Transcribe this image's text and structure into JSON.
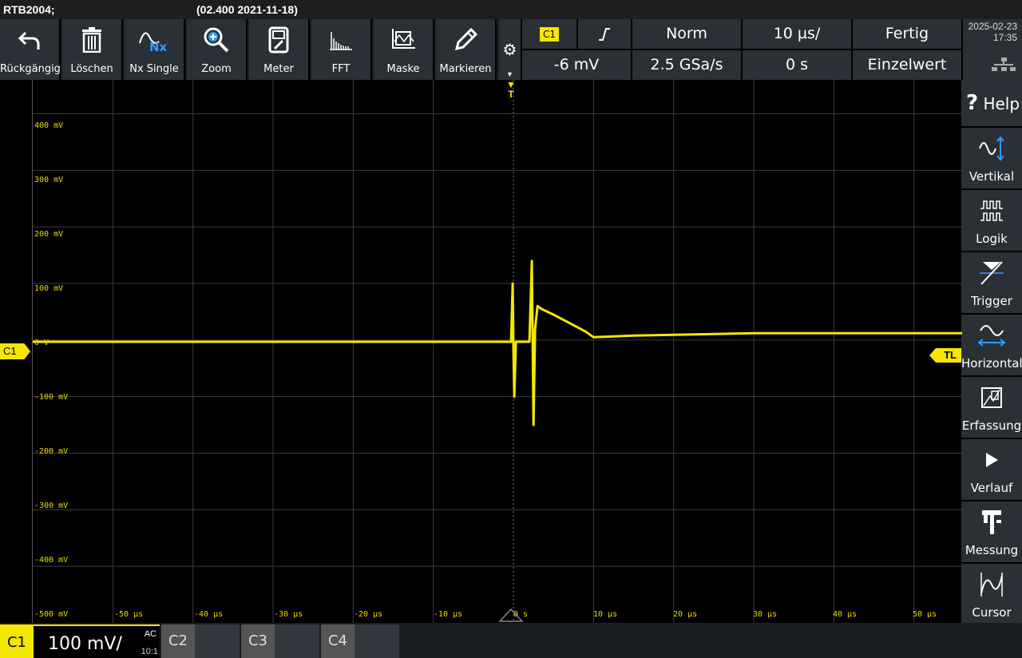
{
  "title": {
    "device": "RTB2004;",
    "firmware": "(02.400 2021-11-18)"
  },
  "toolbar": [
    {
      "label": "Rückgängig",
      "icon": "undo-icon"
    },
    {
      "label": "Löschen",
      "icon": "trash-icon"
    },
    {
      "label": "Nx Single",
      "icon": "nx-single-icon"
    },
    {
      "label": "Zoom",
      "icon": "zoom-icon"
    },
    {
      "label": "Meter",
      "icon": "meter-icon"
    },
    {
      "label": "FFT",
      "icon": "fft-icon"
    },
    {
      "label": "Maske",
      "icon": "mask-icon"
    },
    {
      "label": "Markieren",
      "icon": "pen-icon"
    }
  ],
  "status": {
    "trigger_source": "C1",
    "trigger_slope": "rising-edge",
    "trigger_mode": "Norm",
    "timebase": "10 µs/",
    "state": "Fertig",
    "trigger_level": "-6 mV",
    "sample_rate": "2.5 GSa/s",
    "horizontal_position": "0 s",
    "acquisition": "Einzelwert"
  },
  "clock": {
    "date": "2025-02-23",
    "time": "17:35"
  },
  "right_menu": [
    {
      "label": "Help",
      "prefix": "?",
      "icon": "help-icon"
    },
    {
      "label": "Vertikal",
      "icon": "vertical-icon"
    },
    {
      "label": "Logik",
      "icon": "logic-icon"
    },
    {
      "label": "Trigger",
      "icon": "trigger-icon"
    },
    {
      "label": "Horizontal",
      "icon": "horizontal-icon"
    },
    {
      "label": "Erfassung",
      "icon": "acquisition-icon"
    },
    {
      "label": "Verlauf",
      "icon": "play-icon"
    },
    {
      "label": "Messung",
      "icon": "caliper-icon"
    },
    {
      "label": "Cursor",
      "icon": "cursor-icon"
    }
  ],
  "plot": {
    "y_labels": [
      "400 mV",
      "300 mV",
      "200 mV",
      "100 mV",
      "0 V",
      "-100 mV",
      "-200 mV",
      "-300 mV",
      "-400 mV",
      "-500 mV"
    ],
    "x_labels": [
      "-50 µs",
      "-40 µs",
      "-30 µs",
      "-20 µs",
      "-10 µs",
      "0 s",
      "10 µs",
      "20 µs",
      "30 µs",
      "40 µs",
      "50 µs"
    ],
    "channel_marker": "C1",
    "trigger_level_marker": "TL",
    "trigger_position_marker": "T",
    "trace_color": "#f5e700"
  },
  "chart_data": {
    "type": "line",
    "xlabel": "",
    "ylabel": "",
    "x_unit": "µs",
    "y_unit": "mV",
    "xlim": [
      -60,
      56
    ],
    "ylim": [
      -500,
      460
    ],
    "grid": true,
    "series": [
      {
        "x": [
          -60,
          -10,
          -0.3,
          -0.1,
          0,
          0.1,
          0.3,
          2,
          2.3,
          2.5,
          2.7,
          3,
          3.5,
          5,
          7,
          9,
          10,
          15,
          30,
          56
        ],
        "y": [
          -3,
          -3,
          -3,
          100,
          -20,
          -100,
          -3,
          -3,
          140,
          -150,
          20,
          60,
          55,
          45,
          30,
          15,
          5,
          8,
          12,
          12
        ]
      }
    ]
  },
  "channels": [
    {
      "name": "C1",
      "scale": "100 mV/",
      "coupling": "AC",
      "probe": "10:1",
      "active": true
    },
    {
      "name": "C2",
      "active": false
    },
    {
      "name": "C3",
      "active": false
    },
    {
      "name": "C4",
      "active": false
    }
  ]
}
